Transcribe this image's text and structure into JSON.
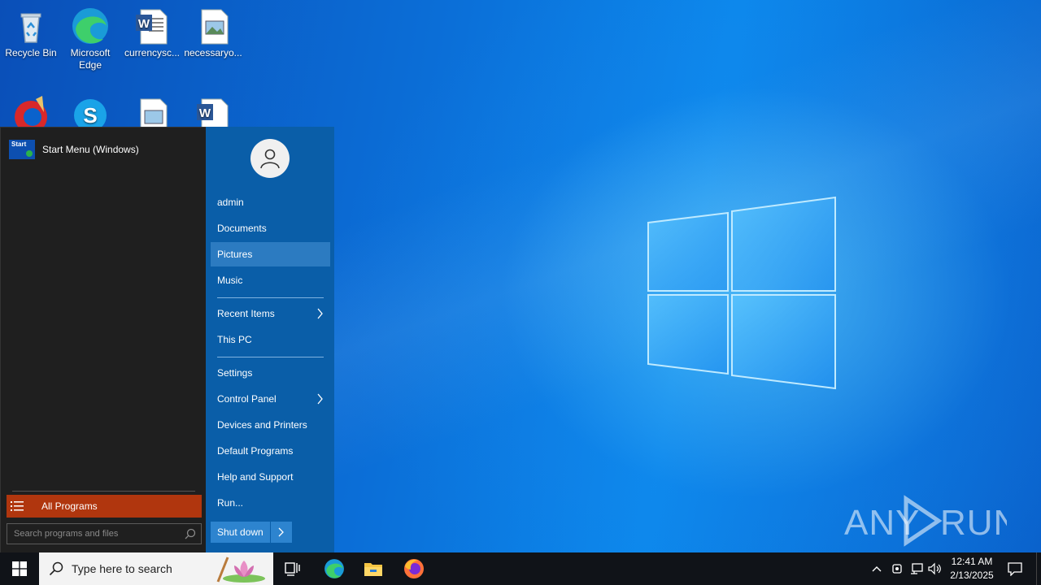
{
  "desktop": {
    "icons": [
      {
        "label": "Recycle Bin",
        "icon": "recycle-bin-icon"
      },
      {
        "label": "Microsoft Edge",
        "icon": "edge-icon"
      },
      {
        "label": "currencysc...",
        "icon": "word-doc-icon"
      },
      {
        "label": "necessaryo...",
        "icon": "image-file-icon"
      },
      {
        "label": "",
        "icon": "ccleaner-icon"
      },
      {
        "label": "",
        "icon": "skype-icon"
      },
      {
        "label": "",
        "icon": "image-file-icon"
      },
      {
        "label": "",
        "icon": "word-doc-icon"
      }
    ],
    "watermark": "ANY RUN"
  },
  "start_menu": {
    "pinned": {
      "label": "Start Menu (Windows)",
      "icon_text": "Start"
    },
    "all_programs": "All Programs",
    "search_placeholder": "Search programs and files",
    "user": "admin",
    "items": [
      {
        "label": "Documents"
      },
      {
        "label": "Pictures",
        "highlighted": true
      },
      {
        "label": "Music"
      },
      {
        "label": "Recent Items",
        "submenu": true
      },
      {
        "label": "This PC"
      },
      {
        "label": "Settings"
      },
      {
        "label": "Control Panel",
        "submenu": true
      },
      {
        "label": "Devices and Printers"
      },
      {
        "label": "Default Programs"
      },
      {
        "label": "Help and Support"
      },
      {
        "label": "Run..."
      }
    ],
    "shutdown": "Shut down"
  },
  "taskbar": {
    "search_placeholder": "Type here to search",
    "apps": [
      "task-view-icon",
      "edge-icon",
      "file-explorer-icon",
      "firefox-icon"
    ],
    "clock_time": "12:41 AM",
    "clock_date": "2/13/2025"
  },
  "colors": {
    "start_left_bg": "#1f1f1f",
    "start_right_bg": "#0a5ea8",
    "all_programs_bg": "#b0360e",
    "highlight": "#2c7bc1",
    "taskbar_bg": "#101318"
  }
}
